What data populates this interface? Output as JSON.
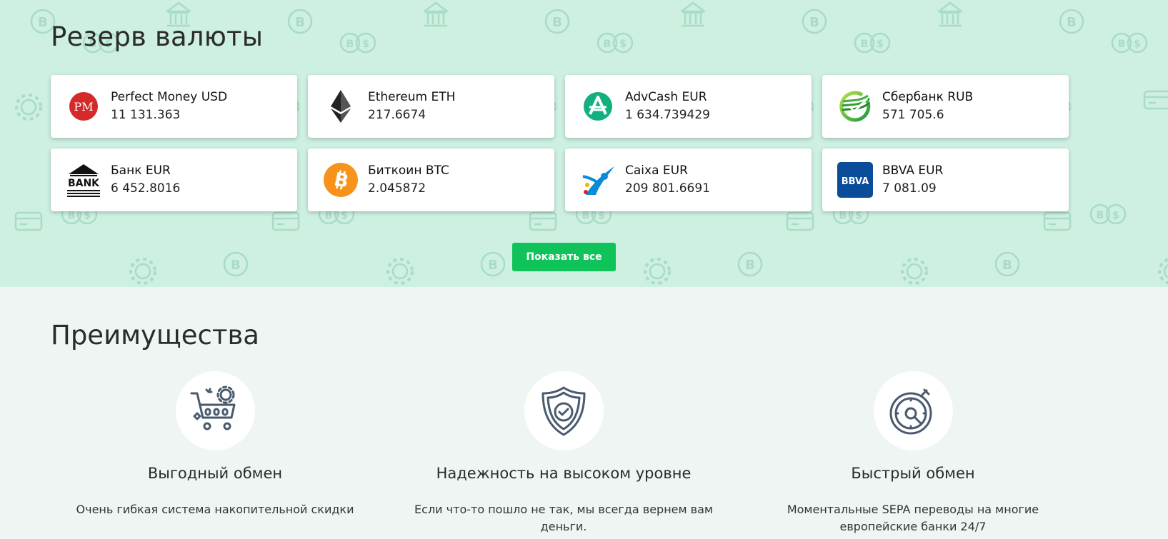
{
  "reserve": {
    "title": "Резерв валюты",
    "show_all_label": "Показать все",
    "currencies": [
      {
        "name": "Perfect Money USD",
        "amount": "11 131.363",
        "icon": "perfect-money-icon"
      },
      {
        "name": "Ethereum ETH",
        "amount": "217.6674",
        "icon": "ethereum-icon"
      },
      {
        "name": "AdvCash EUR",
        "amount": "1 634.739429",
        "icon": "advcash-icon"
      },
      {
        "name": "Сбербанк RUB",
        "amount": "571 705.6",
        "icon": "sberbank-icon"
      },
      {
        "name": "Банк EUR",
        "amount": "6 452.8016",
        "icon": "bank-icon"
      },
      {
        "name": "Биткоин BTC",
        "amount": "2.045872",
        "icon": "bitcoin-icon"
      },
      {
        "name": "Caixa EUR",
        "amount": "209 801.6691",
        "icon": "caixa-icon"
      },
      {
        "name": "BBVA EUR",
        "amount": "7 081.09",
        "icon": "bbva-icon"
      }
    ],
    "logo_text": {
      "perfect_money": "PM",
      "bank": "BANK",
      "bbva": "BBVA"
    }
  },
  "advantages": {
    "title": "Преимущества",
    "items": [
      {
        "title": "Выгодный обмен",
        "text": "Очень гибкая система накопительной скидки",
        "icon": "cart-icon"
      },
      {
        "title": "Надежность на высоком уровне",
        "text": "Если что-то пошло не так, мы всегда вернем вам деньги.",
        "icon": "shield-check-icon"
      },
      {
        "title": "Быстрый обмен",
        "text": "Моментальные SEPA переводы на многие европейские банки 24/7",
        "icon": "stopwatch-icon"
      }
    ]
  },
  "colors": {
    "reserve_bg": "#cdf0e1",
    "pattern": "#a9dcc6",
    "accent_button": "#0fc25a",
    "page_bg": "#eef5f2",
    "icon_stroke": "#4a5a6e"
  }
}
